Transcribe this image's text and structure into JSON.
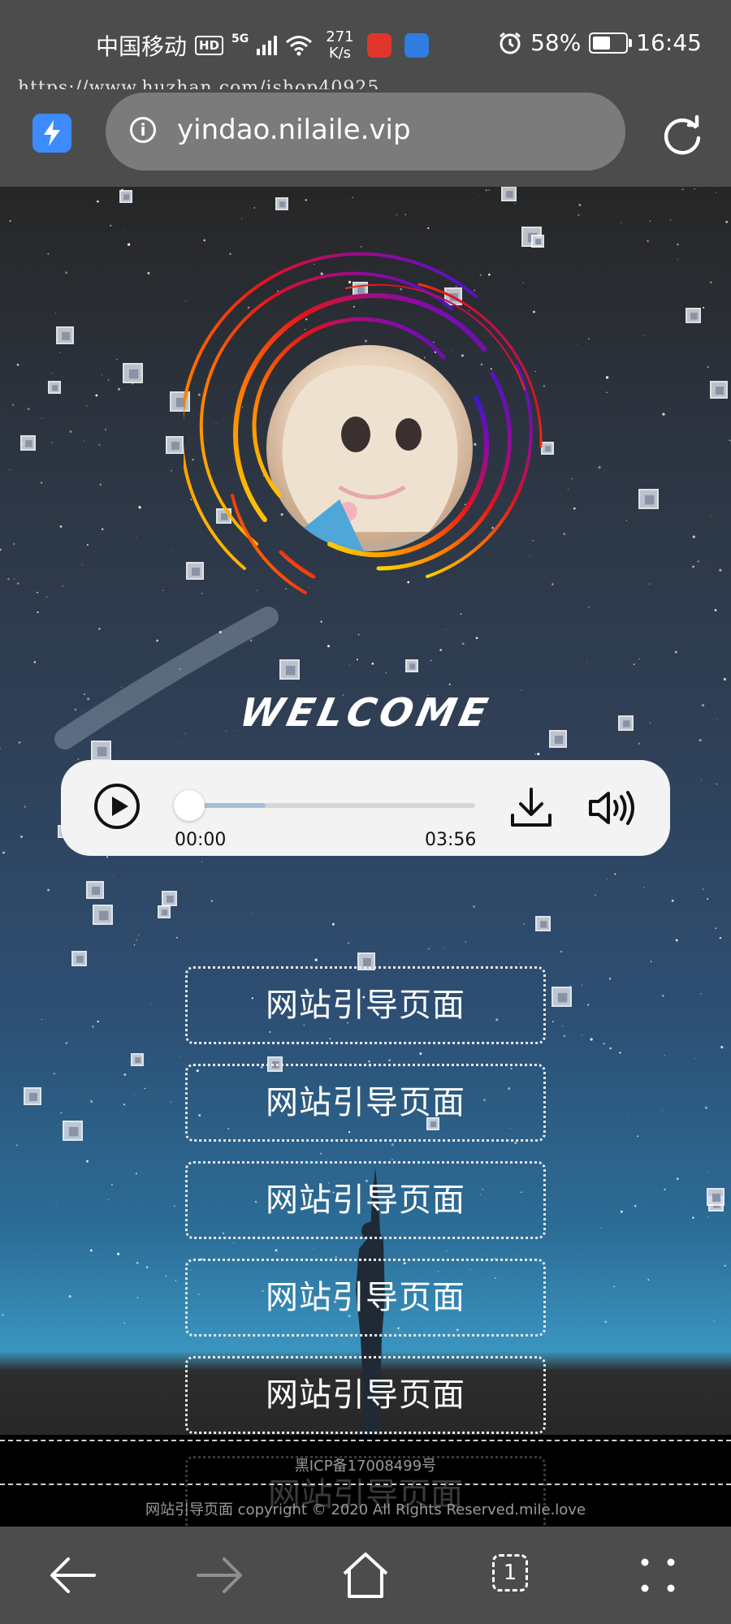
{
  "status_bar": {
    "carrier": "中国移动",
    "hd_badge": "HD",
    "network": "5G",
    "speed_value": "271",
    "speed_unit": "K/s",
    "battery": "58%",
    "battery_level": 0.58,
    "time": "16:45"
  },
  "watermark": "https://www.huzhan.com/ishop40925",
  "browser": {
    "url": "yindao.nilaile.vip"
  },
  "page": {
    "welcome": "WELCOME",
    "player": {
      "current_time": "00:00",
      "duration": "03:56",
      "progress": 0,
      "buffered": 0.3
    },
    "nav_buttons": [
      {
        "label": "网站引导页面"
      },
      {
        "label": "网站引导页面"
      },
      {
        "label": "网站引导页面"
      },
      {
        "label": "网站引导页面"
      },
      {
        "label": "网站引导页面"
      },
      {
        "label": "网站引导页面"
      }
    ],
    "footer": {
      "icp": "黑ICP备17008499号",
      "copyright": "网站引导页面 copyright © 2020 All Rights Reserved.mile.love"
    }
  },
  "bottom_nav": {
    "tab_count": "1"
  },
  "colors": {
    "browser_chrome": "#4c4c4c",
    "accent_blue": "#3d8bff",
    "player_bg": "#f3f3f3"
  }
}
